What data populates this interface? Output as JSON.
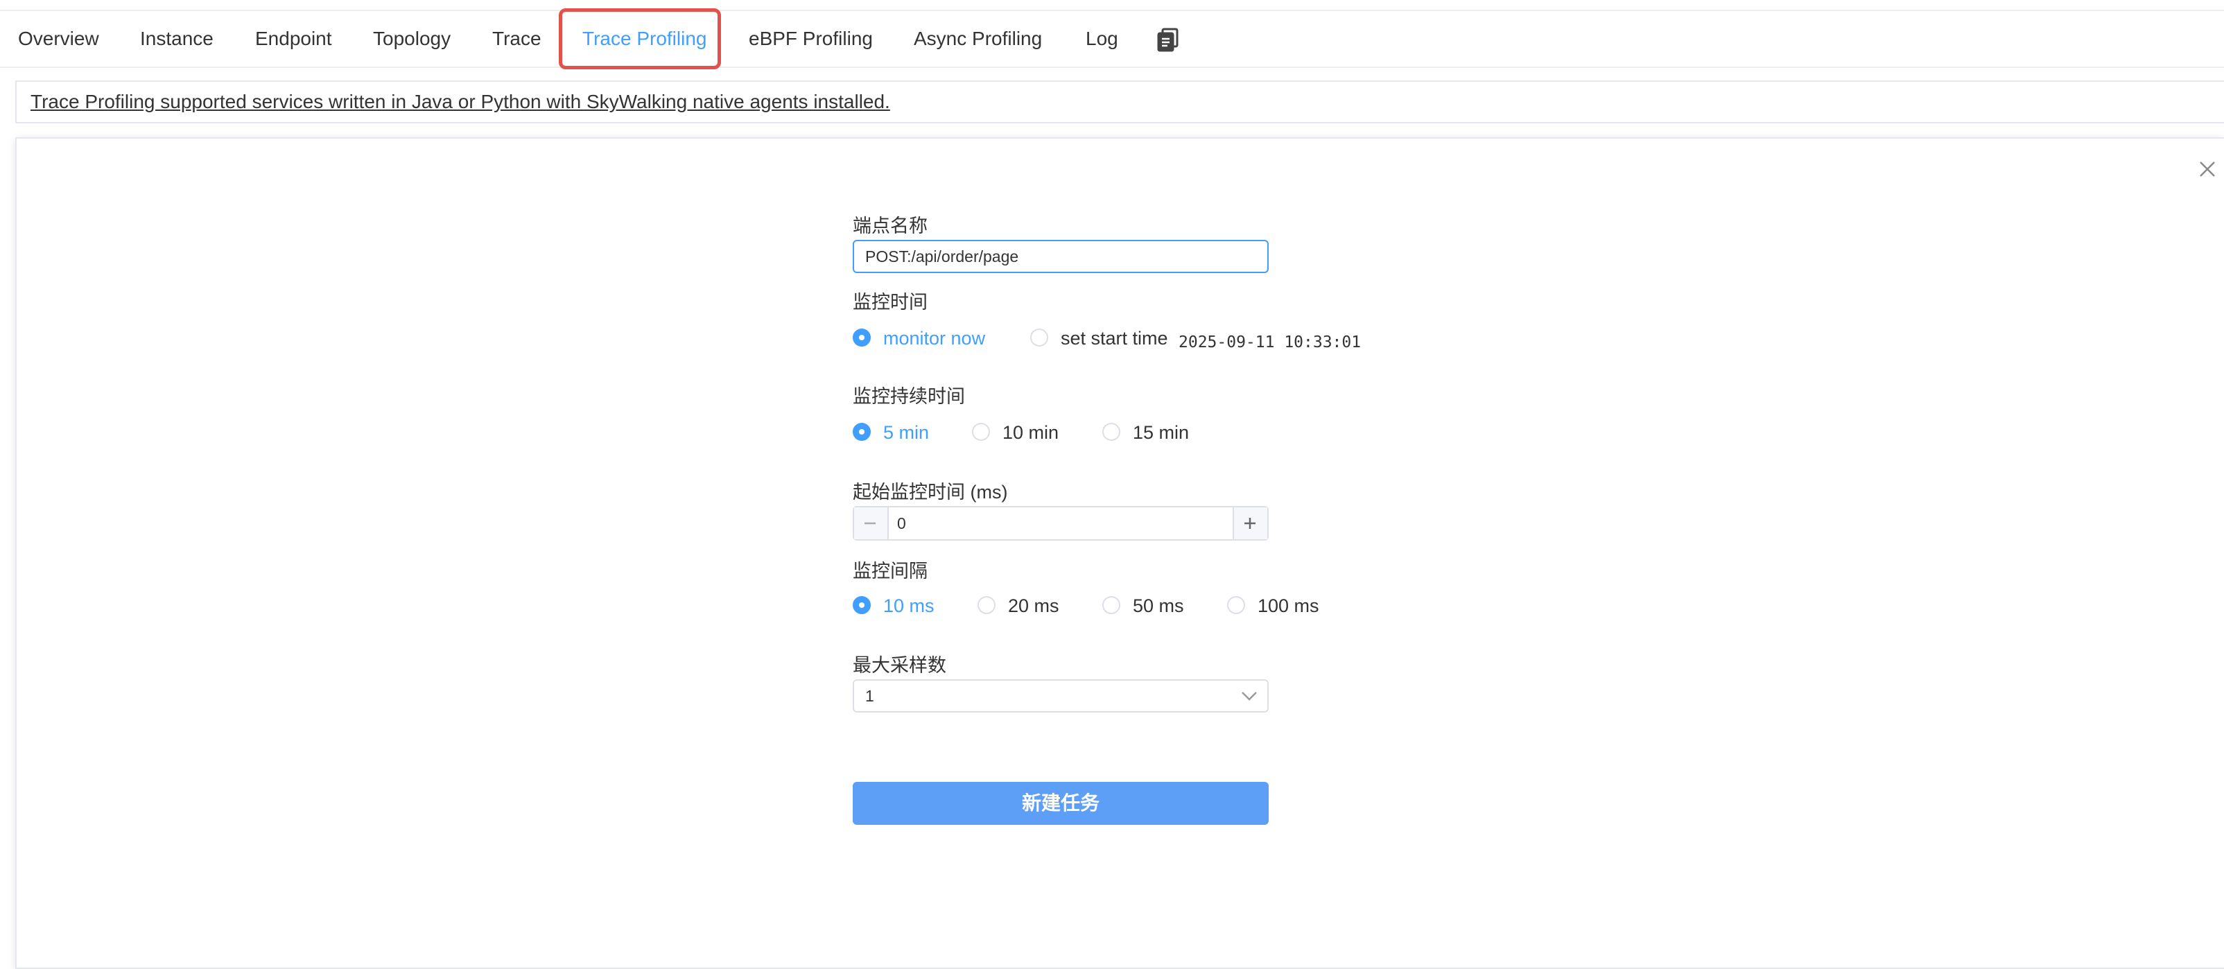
{
  "tabs": [
    {
      "label": "Overview",
      "active": false
    },
    {
      "label": "Instance",
      "active": false
    },
    {
      "label": "Endpoint",
      "active": false
    },
    {
      "label": "Topology",
      "active": false
    },
    {
      "label": "Trace",
      "active": false
    },
    {
      "label": "Trace Profiling",
      "active": true
    },
    {
      "label": "eBPF Profiling",
      "active": false
    },
    {
      "label": "Async Profiling",
      "active": false
    },
    {
      "label": "Log",
      "active": false
    }
  ],
  "copy_icon": "copy-icon",
  "notice": "Trace Profiling supported services written in Java or Python with SkyWalking native agents installed.",
  "form": {
    "endpoint_label": "端点名称",
    "endpoint_value": "POST:/api/order/page",
    "monitor_time_label": "监控时间",
    "monitor_time_options": [
      "monitor now",
      "set start time"
    ],
    "monitor_time_selected": "monitor now",
    "start_time_value": "2025-09-11 10:33:01",
    "duration_label": "监控持续时间",
    "duration_options": [
      "5 min",
      "10 min",
      "15 min"
    ],
    "duration_selected": "5 min",
    "min_threshold_label": "起始监控时间 (ms)",
    "min_threshold_value": "0",
    "interval_label": "监控间隔",
    "interval_options": [
      "10 ms",
      "20 ms",
      "50 ms",
      "100 ms"
    ],
    "interval_selected": "10 ms",
    "max_samples_label": "最大采样数",
    "max_samples_value": "1",
    "submit_label": "新建任务"
  },
  "colors": {
    "accent": "#409eff",
    "button": "#5d9ef6",
    "highlight_box": "#e3524a"
  }
}
